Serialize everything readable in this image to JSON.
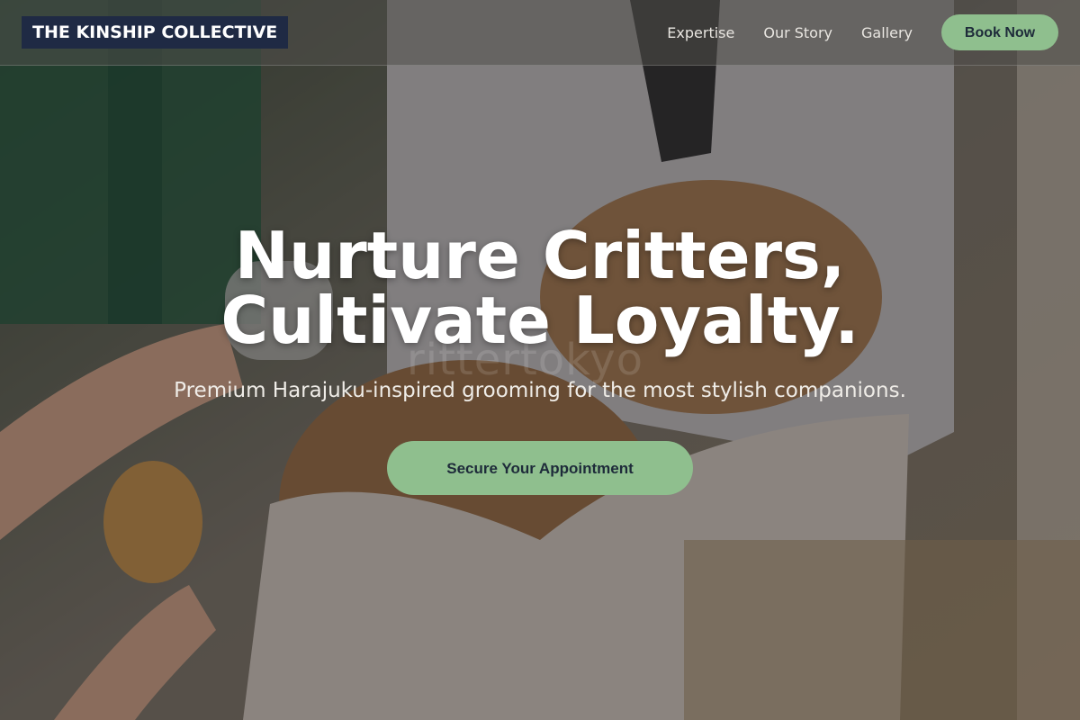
{
  "brand": {
    "logo_text": "THE KINSHIP COLLECTIVE"
  },
  "nav": {
    "links": [
      {
        "label": "Expertise"
      },
      {
        "label": "Our Story"
      },
      {
        "label": "Gallery"
      }
    ],
    "book_label": "Book Now"
  },
  "hero": {
    "headline_line1": "Nurture Critters,",
    "headline_line2": "Cultivate Loyalty.",
    "subheadline": "Premium Harajuku-inspired grooming for the most stylish companions.",
    "cta_label": "Secure Your Appointment",
    "watermark_text": "rittertokyo"
  },
  "colors": {
    "accent": "#8fbf8e",
    "logo_bg": "#1f2a44",
    "button_text": "#1e2b3a"
  }
}
